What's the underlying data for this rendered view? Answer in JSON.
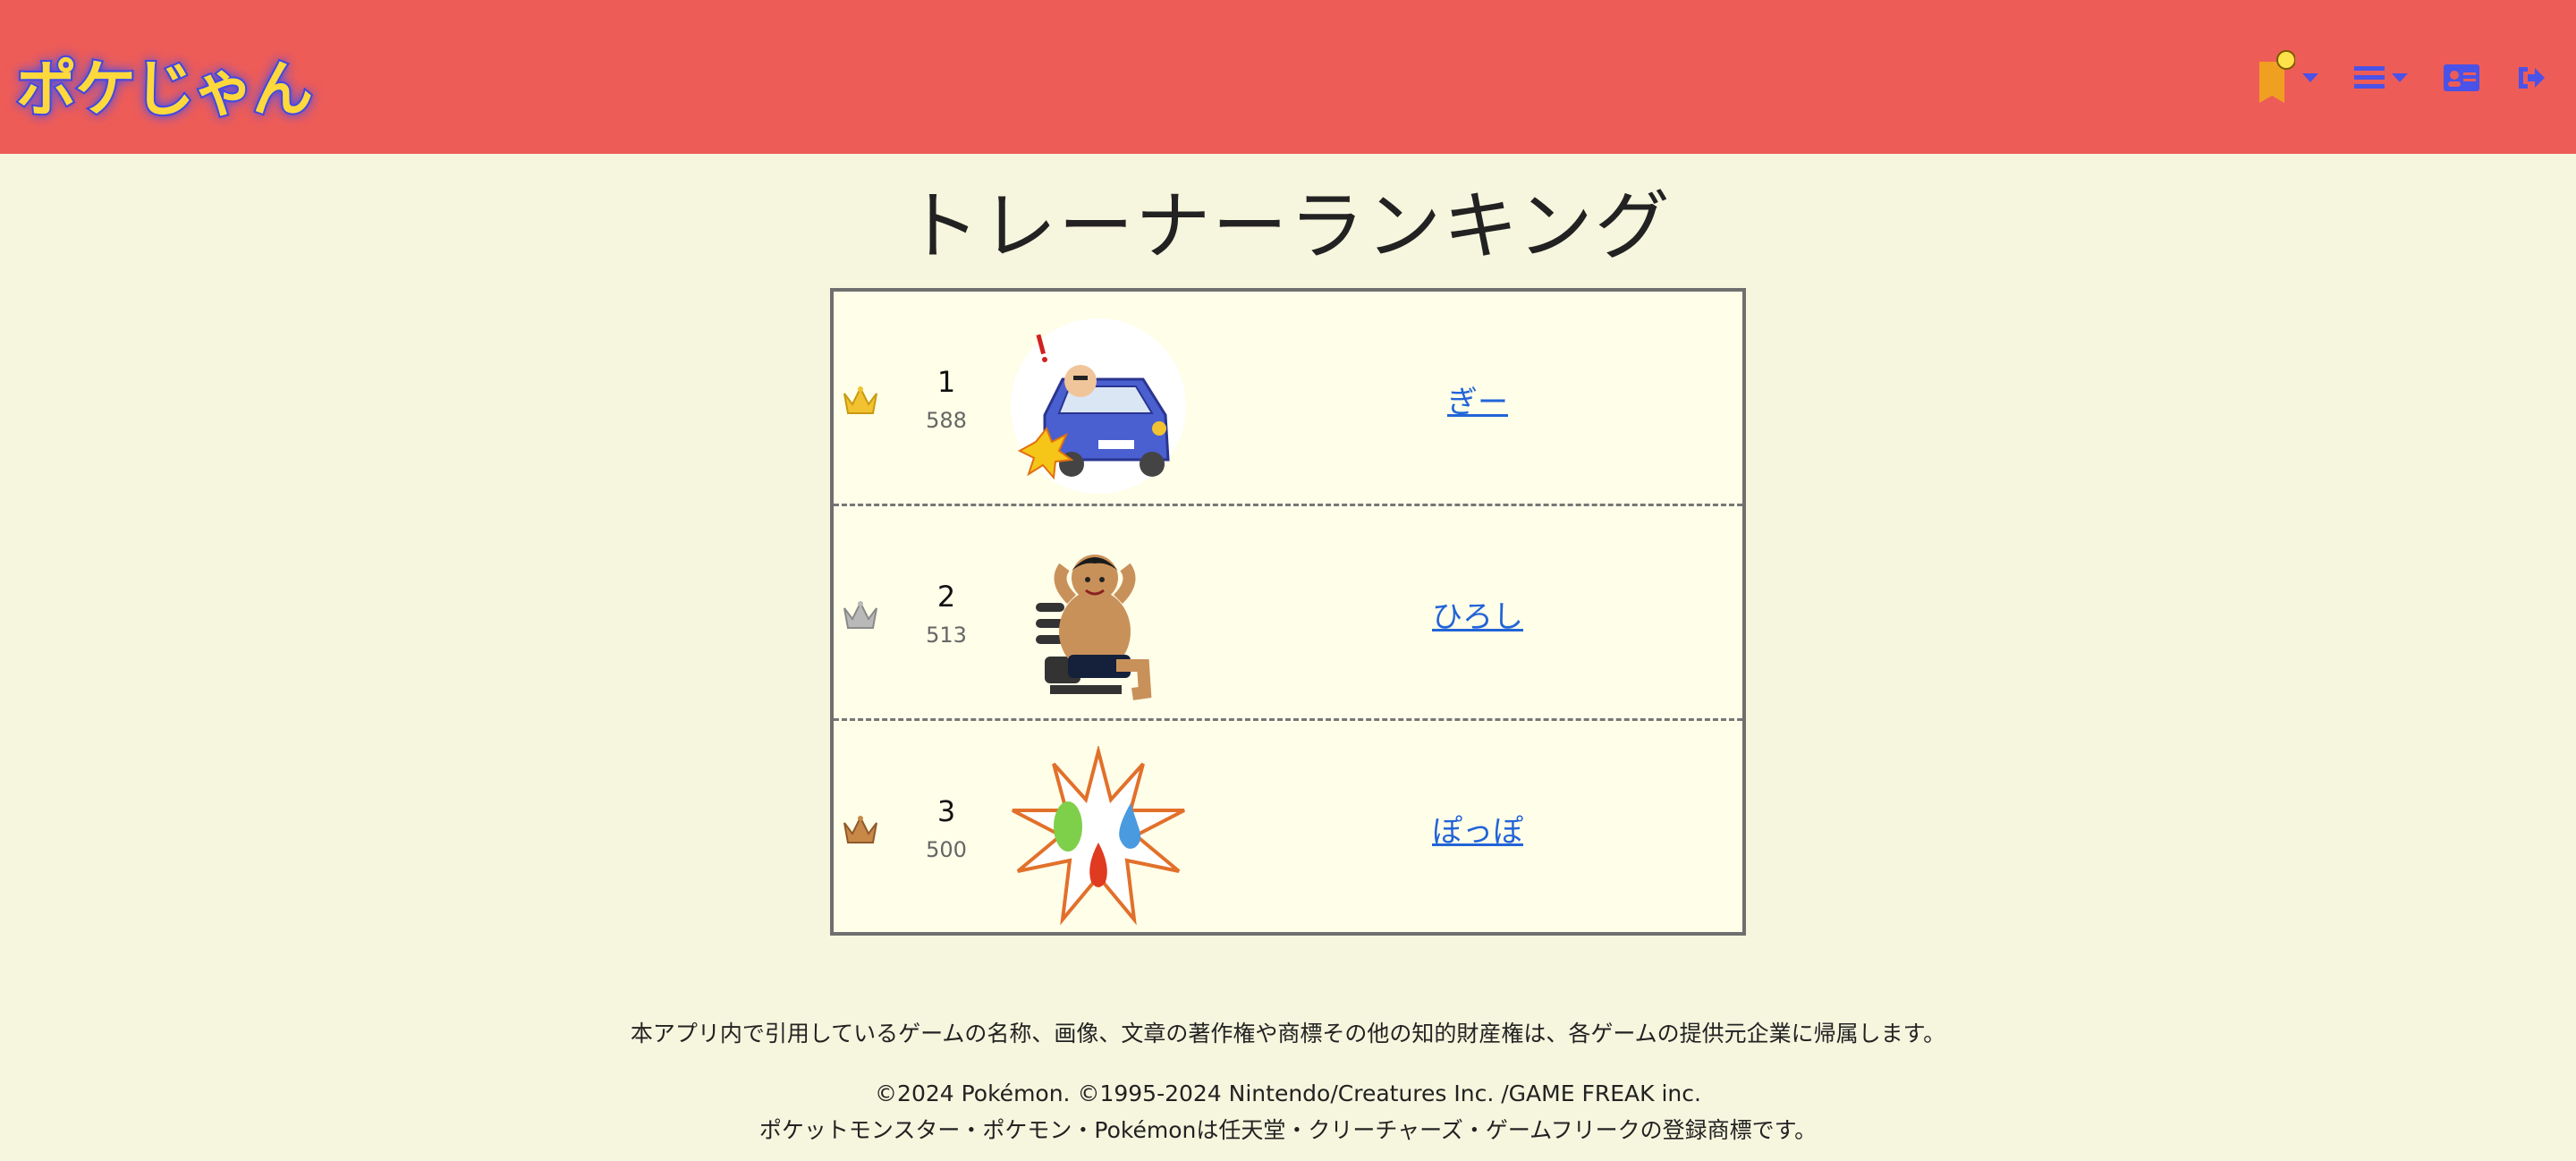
{
  "app": {
    "logo_text": "ポケじゃん"
  },
  "header": {
    "icons": [
      "bookmark-notification-icon",
      "menu-icon",
      "id-card-icon",
      "logout-icon"
    ],
    "colors": {
      "bar": "#ee5c57",
      "icon": "#4a52e8",
      "bookmark": "#f0a020",
      "dot": "#ffe24a"
    }
  },
  "page": {
    "title": "トレーナーランキング"
  },
  "ranking": [
    {
      "rank": "1",
      "score": "588",
      "name": "ぎー",
      "crown": "gold-crown-icon",
      "avatar": "car-accident-illustration"
    },
    {
      "rank": "2",
      "score": "513",
      "name": "ひろし",
      "crown": "silver-crown-icon",
      "avatar": "muscle-workout-illustration"
    },
    {
      "rank": "3",
      "score": "500",
      "name": "ぽっぽ",
      "crown": "bronze-crown-icon",
      "avatar": "grass-water-fire-burst-illustration"
    }
  ],
  "footer": {
    "disclaimer": "本アプリ内で引用しているゲームの名称、画像、文章の著作権や商標その他の知的財産権は、各ゲームの提供元企業に帰属します。",
    "copyright": "©2024 Pokémon. ©1995-2024 Nintendo/Creatures Inc. /GAME FREAK inc.",
    "trademark": "ポケットモンスター・ポケモン・Pokémonは任天堂・クリーチャーズ・ゲームフリークの登録商標です。"
  }
}
